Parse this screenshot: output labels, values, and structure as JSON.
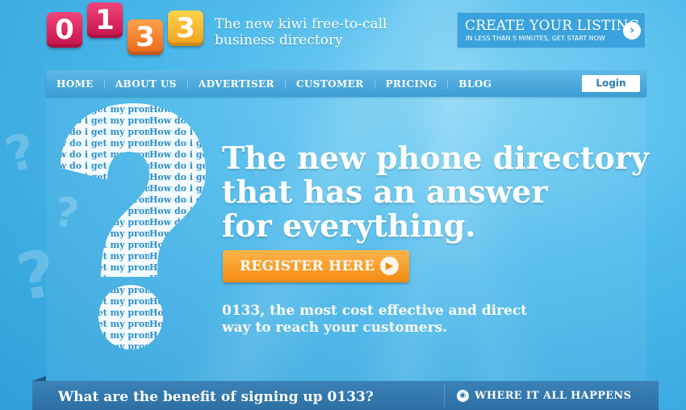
{
  "logo": {
    "digits": [
      "0",
      "1",
      "3",
      "3"
    ]
  },
  "tagline": {
    "line1": "The new kiwi free-to-call",
    "line2": "business directory"
  },
  "cta": {
    "title": "CREATE YOUR LISTING",
    "subtitle": "IN LESS THAN 5 MINUTES, GET START NOW",
    "icon": "arrow-right-icon"
  },
  "nav": {
    "items": [
      {
        "label": "HOME"
      },
      {
        "label": "ABOUT US"
      },
      {
        "label": "ADVERTISER"
      },
      {
        "label": "CUSTOMER"
      },
      {
        "label": "PRICING"
      },
      {
        "label": "BLOG"
      }
    ],
    "login_label": "Login"
  },
  "hero": {
    "title_line1": "The new phone directory",
    "title_line2": "that has an answer",
    "title_line3": "for everything.",
    "register_label": "REGISTER HERE",
    "desc_line1": "0133, the most cost effective and direct",
    "desc_line2": "way to reach your customers.",
    "question_text": "How do i get my promotion heard?"
  },
  "bottom": {
    "benefit": "What are the benefit of signing up 0133?",
    "where": "WHERE IT ALL HAPPENS",
    "icon": "rss-icon"
  },
  "colors": {
    "brand_red": "#c5124b",
    "brand_orange": "#f28a12",
    "brand_yellow": "#f0a01a",
    "sky_blue": "#4fbbec"
  }
}
